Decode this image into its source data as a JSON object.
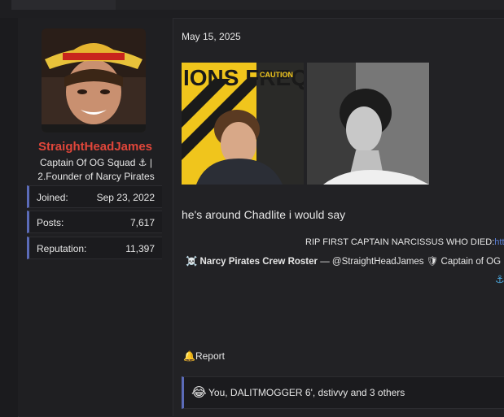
{
  "user": {
    "name": "StraightHeadJames",
    "title_line1": "Captain Of OG Squad ⚓ |",
    "title_line2": "2.Founder of Narcy Pirates",
    "stats": [
      {
        "label": "Joined:",
        "value": "Sep 23, 2022"
      },
      {
        "label": "Posts:",
        "value": "7,617"
      },
      {
        "label": "Reputation:",
        "value": "11,397"
      }
    ]
  },
  "post": {
    "date": "May 15, 2025",
    "image1_text": "IONS FREQUE",
    "image1_caution": "CAUTION",
    "message": "he's around Chadlite i would say",
    "signature_line": "RIP FIRST CAPTAIN NARCISSUS WHO DIED:",
    "signature_link": "htt",
    "roster_title": "Narcy Pirates Crew Roster",
    "roster_rest": " — @StraightHeadJames 🛡 Captain of OG",
    "skull": "☠️",
    "anchor": "⚓",
    "report_icon": "🔔",
    "report_label": "Report",
    "reactions_emoji": "😂",
    "reactions_text": "You, DALITMOGGER 6', dstivvy and 3 others"
  },
  "colors": {
    "username": "#e0463a",
    "accent_border": "#5b6bb8",
    "link": "#5b7fd6",
    "background": "#1b1b1e"
  }
}
